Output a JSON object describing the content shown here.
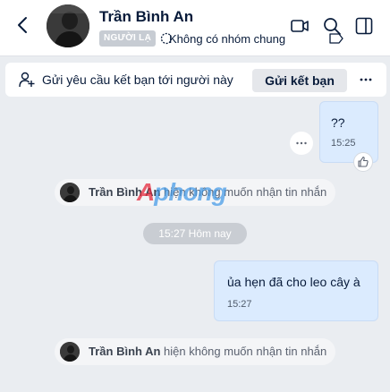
{
  "header": {
    "name": "Trần Bình An",
    "stranger_badge": "NGƯỜI LẠ",
    "mutual_groups": "Không có nhóm chung"
  },
  "friend_request": {
    "text": "Gửi yêu cầu kết bạn tới người này",
    "button": "Gửi kết bạn"
  },
  "messages": [
    {
      "text": "??",
      "time": "15:25"
    },
    {
      "text": "ủa hẹn đã cho leo cây à",
      "time": "15:27"
    }
  ],
  "notices": [
    {
      "name": "Trần Bình An",
      "text": "hiện không muốn nhận tin nhắn"
    },
    {
      "name": "Trần Bình An",
      "text": "hiện không muốn nhận tin nhắn"
    }
  ],
  "date_divider": "15:27 Hôm nay",
  "watermark": {
    "part1": "A",
    "part2": "phong"
  },
  "colors": {
    "my_bubble": "#dbebfe",
    "background": "#eaedf1",
    "text": "#081b3a",
    "stranger_badge": "#c7ccd3"
  },
  "icons": [
    "back-arrow-icon",
    "video-call-icon",
    "search-icon",
    "sidebar-toggle-icon",
    "add-friend-icon",
    "more-icon",
    "like-icon",
    "tag-icon"
  ]
}
